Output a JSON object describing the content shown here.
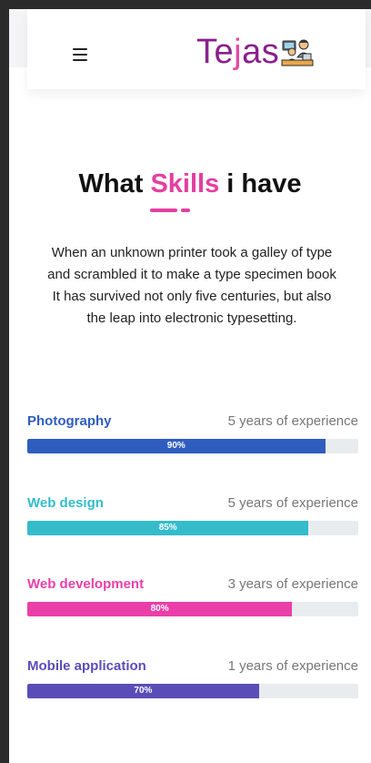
{
  "header": {
    "logo_part1": "Te",
    "logo_part2": "j",
    "logo_part3": "as",
    "logo_icon": "people-at-desk-icon",
    "menu_icon": "hamburger-menu-icon"
  },
  "section": {
    "title_before": "What ",
    "title_accent": "Skills",
    "title_after": " i have",
    "intro": "When an unknown printer took a galley of type and scrambled it to make a type specimen book It has survived not only five centuries, but also the leap into electronic typesetting."
  },
  "skills": [
    {
      "name": "Photography",
      "experience": "5 years of experience",
      "percent": 90,
      "percent_label": "90%",
      "color": "#2f5dbf"
    },
    {
      "name": "Web design",
      "experience": "5 years of experience",
      "percent": 85,
      "percent_label": "85%",
      "color": "#34bccb"
    },
    {
      "name": "Web development",
      "experience": "3 years of experience",
      "percent": 80,
      "percent_label": "80%",
      "color": "#ea3fa9"
    },
    {
      "name": "Mobile application",
      "experience": "1 years of experience",
      "percent": 70,
      "percent_label": "70%",
      "color": "#5a4db8"
    }
  ],
  "colors": {
    "accent": "#e43fa0",
    "logo_primary": "#8a1f8c"
  }
}
